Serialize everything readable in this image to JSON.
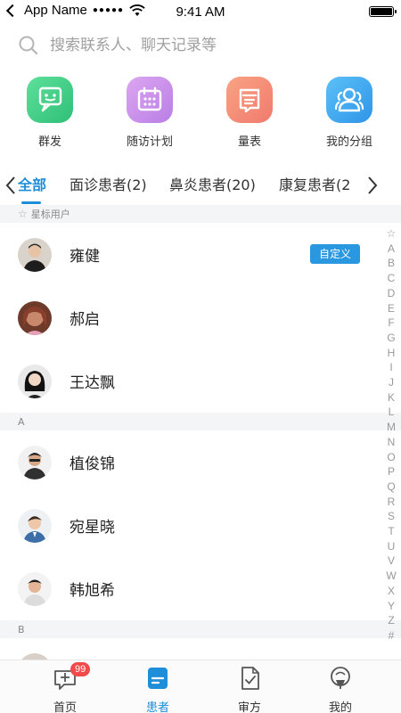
{
  "status_bar": {
    "carrier": "App Name",
    "signal": "●●●●●",
    "time": "9:41 AM",
    "battery_level": 1.0
  },
  "search": {
    "placeholder": "搜索联系人、聊天记录等"
  },
  "quick_actions": [
    {
      "label": "群发",
      "icon": "message-icon",
      "color": "#3fcf8a"
    },
    {
      "label": "随访计划",
      "icon": "calendar-icon",
      "color": "#c98be8"
    },
    {
      "label": "量表",
      "icon": "scale-form-icon",
      "color": "#f5907a"
    },
    {
      "label": "我的分组",
      "icon": "group-icon",
      "color": "#42a9f0"
    }
  ],
  "tabs": [
    {
      "label": "全部",
      "active": true
    },
    {
      "label": "面诊患者(2)"
    },
    {
      "label": "鼻炎患者(20)"
    },
    {
      "label": "康复患者(2"
    }
  ],
  "sections": [
    {
      "header": "星标用户",
      "starred": true,
      "rows": [
        {
          "name": "雍健",
          "tag": "自定义"
        },
        {
          "name": "郝启"
        },
        {
          "name": "王达飘"
        }
      ]
    },
    {
      "header": "A",
      "rows": [
        {
          "name": "植俊锦"
        },
        {
          "name": "宛星晓"
        },
        {
          "name": "韩旭希"
        }
      ]
    },
    {
      "header": "B",
      "rows": []
    }
  ],
  "index": [
    "☆",
    "A",
    "B",
    "C",
    "D",
    "E",
    "F",
    "G",
    "H",
    "I",
    "J",
    "K",
    "L",
    "M",
    "N",
    "O",
    "P",
    "Q",
    "R",
    "S",
    "T",
    "U",
    "V",
    "W",
    "X",
    "Y",
    "Z",
    "#"
  ],
  "bottom_nav": [
    {
      "label": "首页",
      "icon": "home-chat-icon",
      "badge": "99"
    },
    {
      "label": "患者",
      "icon": "patient-icon",
      "active": true
    },
    {
      "label": "审方",
      "icon": "prescription-icon"
    },
    {
      "label": "我的",
      "icon": "profile-icon"
    }
  ],
  "colors": {
    "accent": "#1e8ed8",
    "badge": "#f04a4a",
    "tag": "#2a98e0"
  }
}
